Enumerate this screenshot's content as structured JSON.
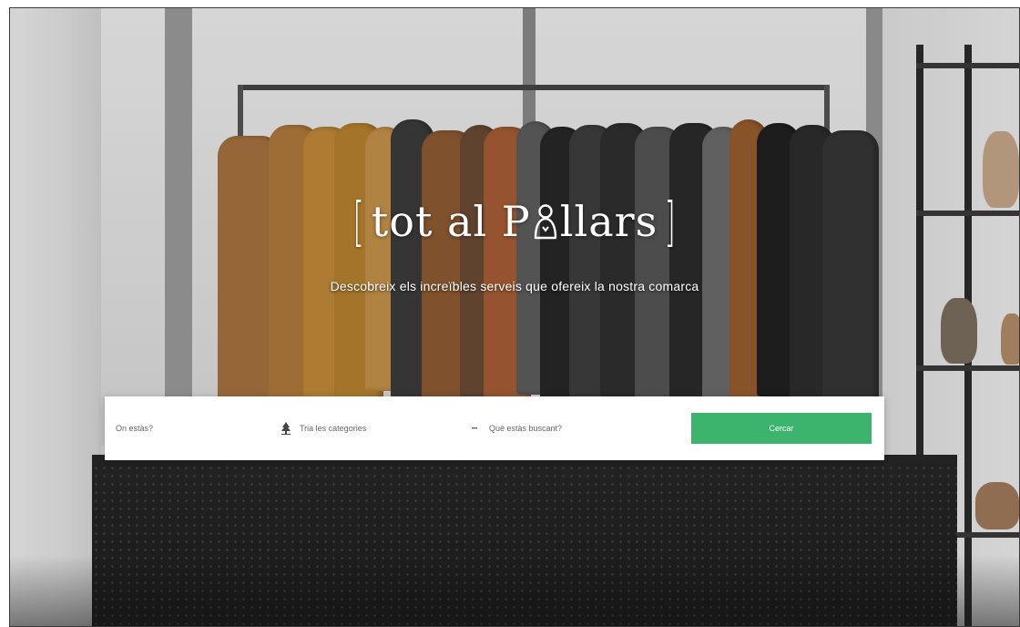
{
  "hero": {
    "logo": {
      "bracket_left": "[",
      "text_before_icon": "tot al P",
      "icon": "person-silhouette-icon",
      "text_after_icon": "llars",
      "bracket_right": "]"
    },
    "tagline": "Descobreix els increïbles serveis que ofereix la nostra comarca"
  },
  "search": {
    "where_placeholder": "On estàs?",
    "category_placeholder": "Tria les categories",
    "what_placeholder": "Què estàs buscant?",
    "button_label": "Cercar",
    "category_icon": "tree-icon",
    "what_icon": "dash-icon"
  },
  "colors": {
    "accent_green": "#3cb46e",
    "text_white": "#ffffff"
  }
}
